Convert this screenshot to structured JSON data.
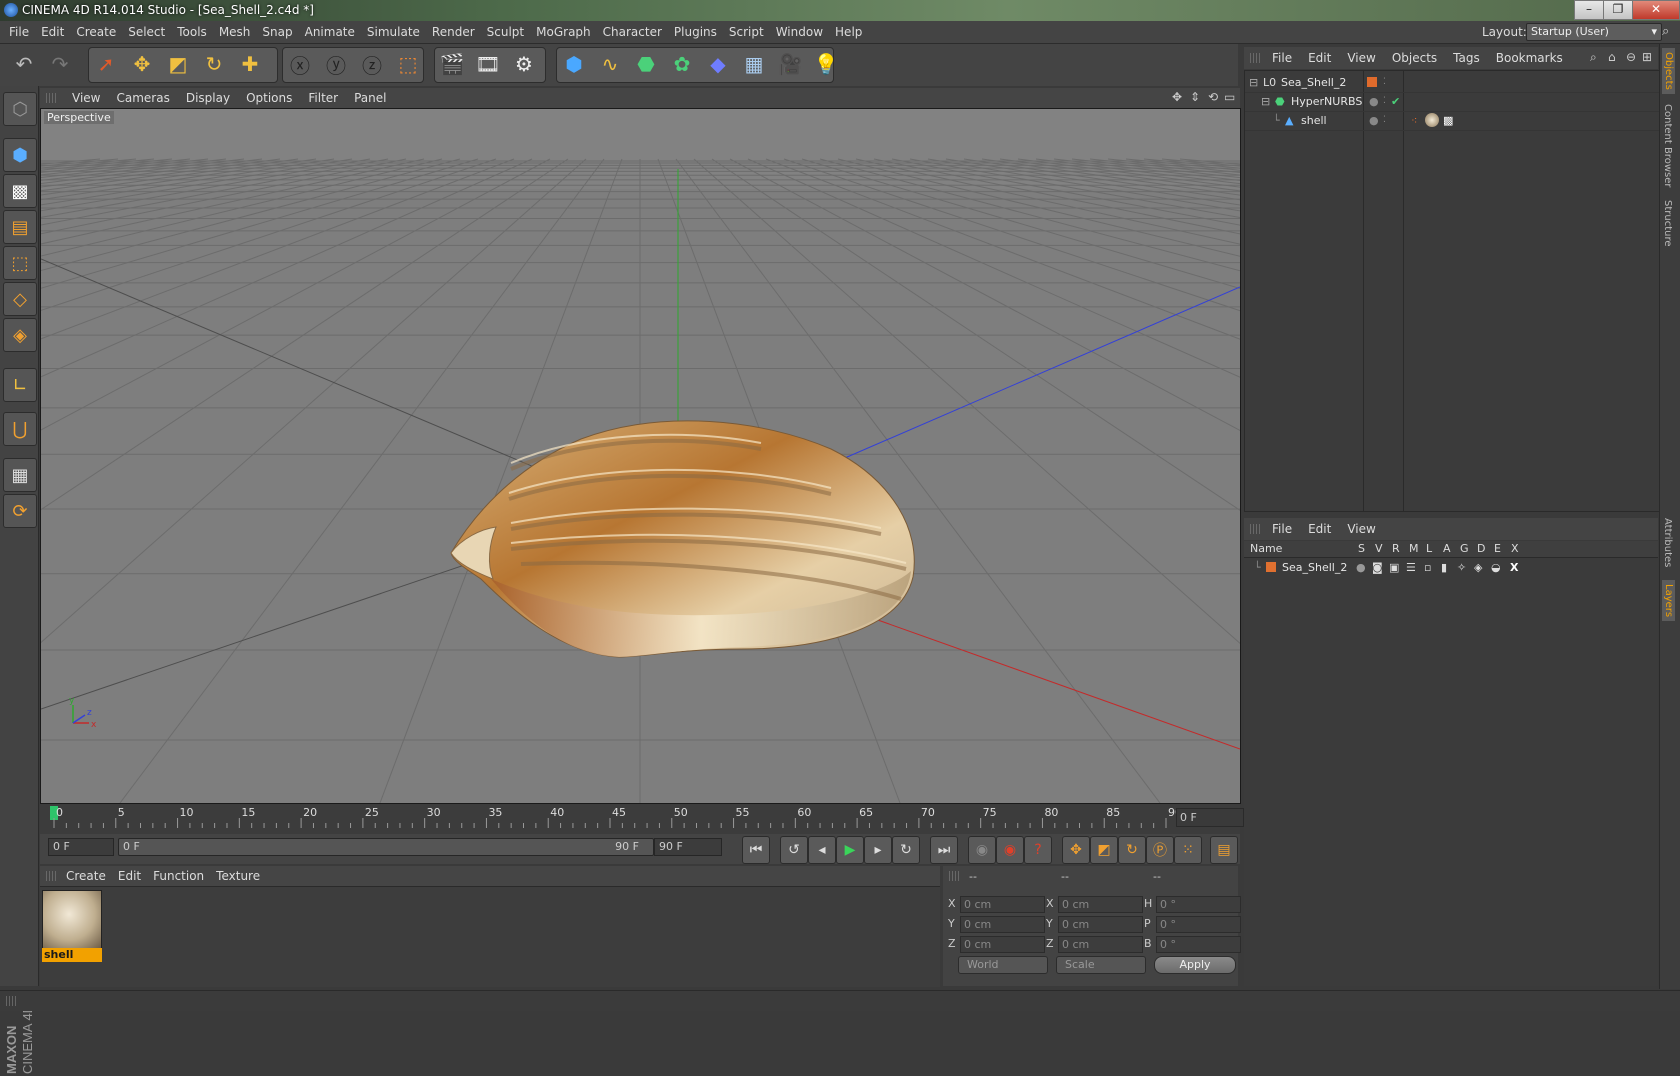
{
  "window": {
    "title": "CINEMA 4D R14.014 Studio - [Sea_Shell_2.c4d *]",
    "buttons": [
      "–",
      "❐",
      "✕"
    ]
  },
  "menubar": {
    "items": [
      "File",
      "Edit",
      "Create",
      "Select",
      "Tools",
      "Mesh",
      "Snap",
      "Animate",
      "Simulate",
      "Render",
      "Sculpt",
      "MoGraph",
      "Character",
      "Plugins",
      "Script",
      "Window",
      "Help"
    ],
    "layout_label": "Layout:",
    "layout_value": "Startup (User)"
  },
  "viewport": {
    "menu": [
      "View",
      "Cameras",
      "Display",
      "Options",
      "Filter",
      "Panel"
    ],
    "camera_label": "Perspective",
    "axis_colors": {
      "x": "#c42a2a",
      "y": "#2fa82f",
      "z": "#2f3fd0"
    }
  },
  "timeline": {
    "ticks": [
      "0",
      "5",
      "10",
      "15",
      "20",
      "25",
      "30",
      "35",
      "40",
      "45",
      "50",
      "55",
      "60",
      "65",
      "70",
      "75",
      "80",
      "85",
      "90"
    ],
    "current_frame_display": "0 F"
  },
  "transport": {
    "start_field": "0 F",
    "range_start": "0 F",
    "range_end": "90 F",
    "end_field": "90 F"
  },
  "material_manager": {
    "menu": [
      "Create",
      "Edit",
      "Function",
      "Texture"
    ],
    "material_name": "shell"
  },
  "coordinates": {
    "header": [
      "--",
      "--",
      "--"
    ],
    "rows": [
      {
        "l1": "X",
        "v1": "0 cm",
        "l2": "X",
        "v2": "0 cm",
        "l3": "H",
        "v3": "0 °"
      },
      {
        "l1": "Y",
        "v1": "0 cm",
        "l2": "Y",
        "v2": "0 cm",
        "l3": "P",
        "v3": "0 °"
      },
      {
        "l1": "Z",
        "v1": "0 cm",
        "l2": "Z",
        "v2": "0 cm",
        "l3": "B",
        "v3": "0 °"
      }
    ],
    "space_dropdown": "World",
    "mode_dropdown": "Scale",
    "apply_label": "Apply"
  },
  "object_manager": {
    "menu": [
      "File",
      "Edit",
      "View",
      "Objects",
      "Tags",
      "Bookmarks"
    ],
    "objects": [
      {
        "name": "Sea_Shell_2"
      },
      {
        "name": "HyperNURBS"
      },
      {
        "name": "shell"
      }
    ]
  },
  "layer_manager": {
    "menu": [
      "File",
      "Edit",
      "View"
    ],
    "columns": [
      "Name",
      "S",
      "V",
      "R",
      "M",
      "L",
      "A",
      "G",
      "D",
      "E",
      "X"
    ],
    "layers": [
      {
        "name": "Sea_Shell_2",
        "color": "#e07030"
      }
    ]
  },
  "side_tabs": [
    "Objects",
    "Content Browser",
    "Structure",
    "Attributes",
    "Layers"
  ],
  "brand": {
    "maxon": "MAXON",
    "product": "CINEMA 4D"
  }
}
